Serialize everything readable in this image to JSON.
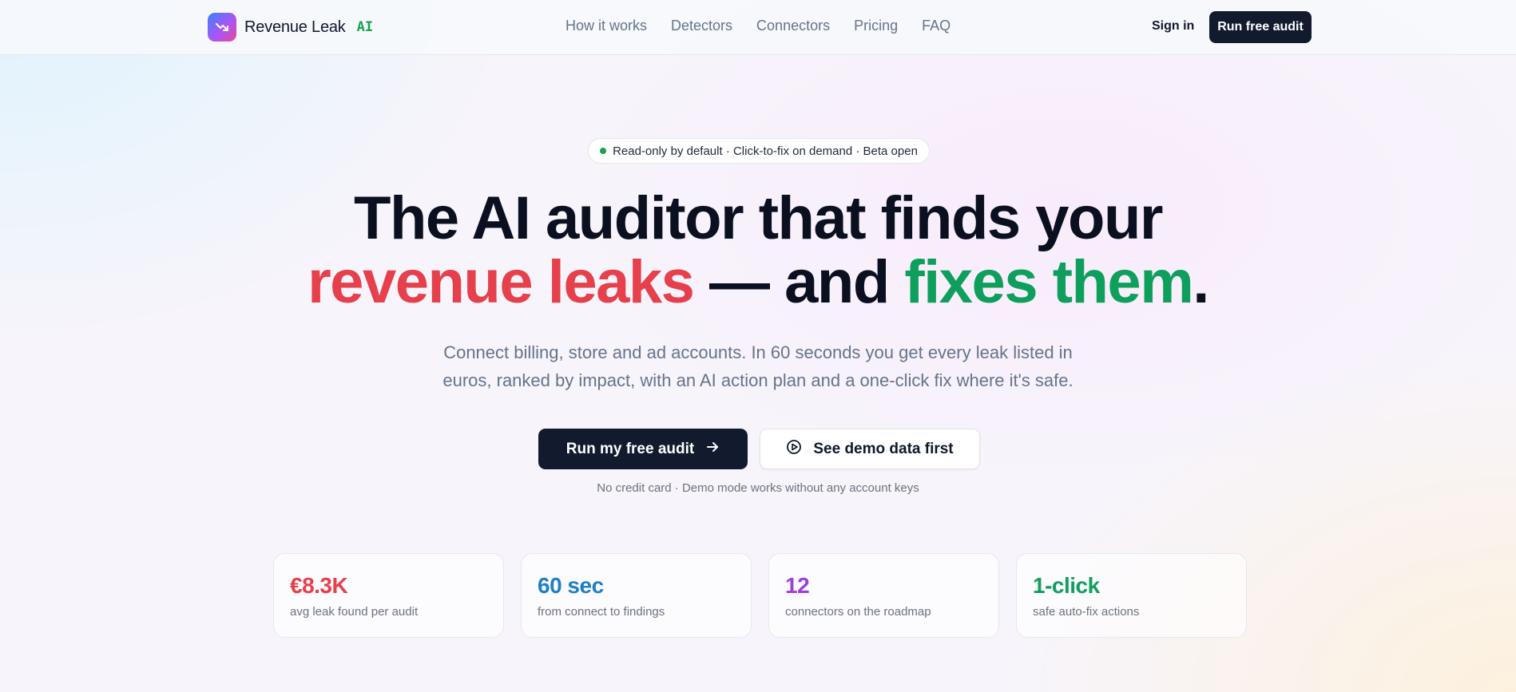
{
  "header": {
    "brand_name": "Revenue Leak",
    "brand_badge": "AI",
    "logo_icon": "trending-down-icon",
    "nav": [
      {
        "label": "How it works"
      },
      {
        "label": "Detectors"
      },
      {
        "label": "Connectors"
      },
      {
        "label": "Pricing"
      },
      {
        "label": "FAQ"
      }
    ],
    "signin_label": "Sign in",
    "cta_label": "Run free audit"
  },
  "hero": {
    "badge_text": "Read-only by default · Click-to-fix on demand · Beta open",
    "headline_line1": "The AI auditor that finds your",
    "headline_red": "revenue leaks",
    "headline_mid": " — and ",
    "headline_green": "fixes them",
    "headline_end": ".",
    "subtitle_line1": "Connect billing, store and ad accounts. In 60 seconds you get every leak listed in",
    "subtitle_line2": "euros, ranked by impact, with an AI action plan and a one-click fix where it's safe.",
    "primary_cta": "Run my free audit",
    "primary_cta_icon": "arrow-right-icon",
    "secondary_cta": "See demo data first",
    "secondary_cta_icon": "play-circle-icon",
    "fine_print": "No credit card · Demo mode works without any account keys"
  },
  "stats": [
    {
      "value": "€8.3K",
      "label": "avg leak found per audit",
      "color": "#e5404b"
    },
    {
      "value": "60 sec",
      "label": "from connect to findings",
      "color": "#1f7fc4"
    },
    {
      "value": "12",
      "label": "connectors on the roadmap",
      "color": "#9b3fd6"
    },
    {
      "value": "1-click",
      "label": "safe auto-fix actions",
      "color": "#0f9f5c"
    }
  ],
  "colors": {
    "accent_dark": "#121a2e",
    "red": "#e5404b",
    "green": "#0f9f5c",
    "status_dot": "#16a34a"
  }
}
